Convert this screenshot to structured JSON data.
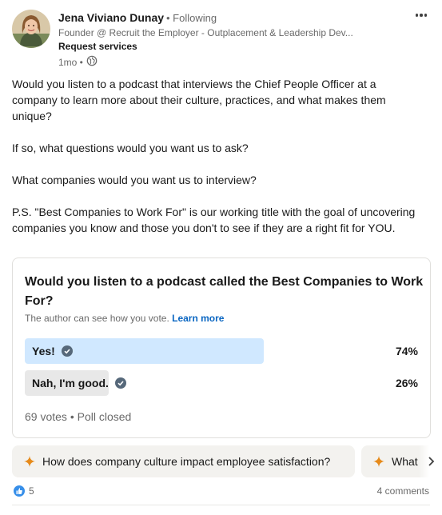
{
  "author": {
    "name": "Jena Viviano Dunay",
    "follow_status": "• Following",
    "headline": "Founder @ Recruit the Employer - Outplacement & Leadership Dev...",
    "cta": "Request services",
    "time": "1mo •",
    "visibility_icon": "globe-icon"
  },
  "menu_icon": "more-horizontal-icon",
  "post": {
    "paragraphs": [
      "Would you listen to a podcast that interviews the Chief People Officer at a company to learn more about their culture, practices, and what makes them unique?",
      "If so, what questions would you want us to ask?",
      "What companies would you want us to interview?",
      "P.S. \"Best Companies to Work For\" is our working title with the goal of uncovering companies you know and those you don't to see if they are a right fit for YOU."
    ]
  },
  "poll": {
    "question": "Would you listen to a podcast called the Best Companies to Work For?",
    "note": "The author can see how you vote.",
    "learn_more": "Learn more",
    "options": [
      {
        "label": "Yes!",
        "percent": "74%",
        "fraction": 0.74,
        "selected": true
      },
      {
        "label": "Nah, I'm good.",
        "percent": "26%",
        "fraction": 0.26,
        "selected": false
      }
    ],
    "votes": "69 votes",
    "status": "• Poll closed"
  },
  "ai_prompts": [
    "How does company culture impact employee satisfaction?",
    "What"
  ],
  "social": {
    "reaction_count": "5",
    "comments": "4 comments"
  },
  "colors": {
    "accent": "#0a66c2",
    "selected_fill": "#d0e8ff",
    "unselected_fill": "#e8e8e8",
    "check": "#56687a",
    "spark": "#e68a1a",
    "like": "#378fe9"
  }
}
